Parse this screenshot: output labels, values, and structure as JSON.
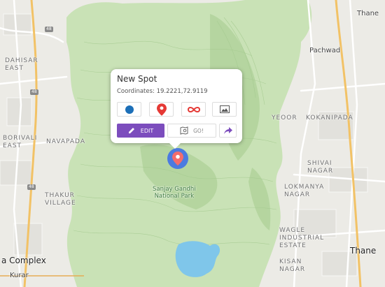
{
  "map": {
    "labels": {
      "pachwad": "Pachwad",
      "thane_top": "Thane",
      "dahisar_east": "DAHISAR\nEAST",
      "borivali_east": "BORIVALI\nEAST",
      "navapada": "NAVAPADA",
      "thakur_village": "THAKUR\nVILLAGE",
      "yeoor": "YEOOR",
      "kokanipada": "KOKANIPADA",
      "shivai_nagar": "SHIVAI\nNAGAR",
      "lokmanya_nagar": "LOKMANYA\nNAGAR",
      "wagle_estate": "WAGLE\nINDUSTRIAL\nESTATE",
      "kisan_nagar": "KISAN\nNAGAR",
      "thane_bottom": "Thane",
      "complex": "a Complex",
      "kurar": "Kurar",
      "park": "Sanjay Gandhi\nNational Park",
      "hw_48_a": "48",
      "hw_48_b": "48",
      "hw_48_c": "48"
    },
    "colors": {
      "park_green": "#c5dfb4",
      "water": "#7fc6ea",
      "city": "#e9e8e3",
      "road": "#ffffff",
      "highway": "#f2c266"
    }
  },
  "popup": {
    "title": "New Spot",
    "coordinates": "Coordinates: 19.2221,72.9119",
    "icons": [
      "circle-icon",
      "pin-icon",
      "infinity-icon",
      "image-icon"
    ],
    "edit_label": "EDIT",
    "go_label": "GO!",
    "accent_color": "#7c4dbd"
  },
  "marker": {
    "color": "#4b7be0",
    "pin_color": "#f46c6c"
  }
}
